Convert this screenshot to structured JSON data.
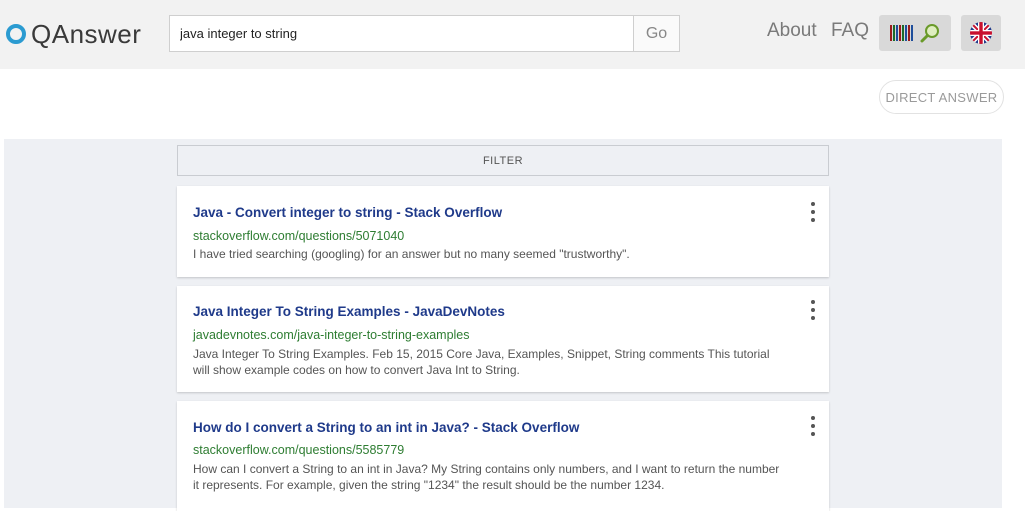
{
  "logo": {
    "text": "QAnswer",
    "ring_color": "#2b9bd1"
  },
  "search": {
    "value": "java integer to string",
    "go_label": "Go"
  },
  "nav": {
    "about": "About",
    "faq": "FAQ"
  },
  "icons": {
    "wiki": "wikidata-search-icon",
    "language": "uk-flag-icon"
  },
  "direct_answer_label": "DIRECT ANSWER",
  "filter_label": "FILTER",
  "colors": {
    "title": "#1f3a8a",
    "url": "#2e7d32",
    "header_bg": "#f2f2f2",
    "results_bg": "#eef0f4"
  },
  "results": [
    {
      "title": "Java - Convert integer to string - Stack Overflow",
      "url": "stackoverflow.com/questions/5071040",
      "snippet": "I have tried searching (googling) for an answer but no many seemed \"trustworthy\"."
    },
    {
      "title": "Java Integer To String Examples - JavaDevNotes",
      "url": "javadevnotes.com/java-integer-to-string-examples",
      "snippet": "Java Integer To String Examples. Feb 15, 2015 Core Java, Examples, Snippet, String comments This tutorial will show example codes on how to convert Java Int to String."
    },
    {
      "title": "How do I convert a String to an int in Java? - Stack Overflow",
      "url": "stackoverflow.com/questions/5585779",
      "snippet": "How can I convert a String to an int in Java? My String contains only numbers, and I want to return the number it represents. For example, given the string \"1234\" the result should be the number 1234."
    }
  ]
}
